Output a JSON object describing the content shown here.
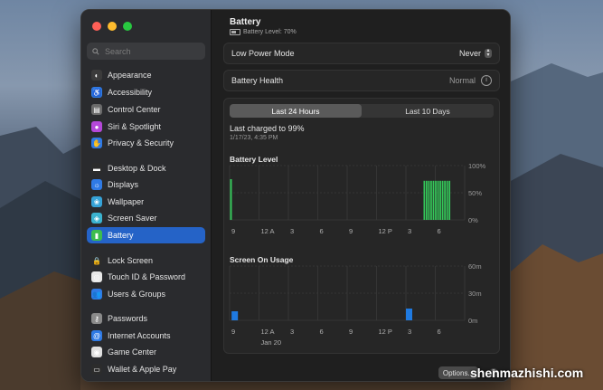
{
  "window": {
    "title": "Battery",
    "subtitle": "Battery Level: 70%"
  },
  "search": {
    "placeholder": "Search"
  },
  "sidebar": {
    "items": [
      {
        "label": "Appearance",
        "icon": "appearance-icon",
        "color": "#3b3b3b"
      },
      {
        "label": "Accessibility",
        "icon": "accessibility-icon",
        "color": "#2f7ae5"
      },
      {
        "label": "Control Center",
        "icon": "control-center-icon",
        "color": "#6b6b6b"
      },
      {
        "label": "Siri & Spotlight",
        "icon": "siri-icon",
        "color": "#b548d9"
      },
      {
        "label": "Privacy & Security",
        "icon": "hand-icon",
        "color": "#2f7ae5"
      },
      {
        "label": "Desktop & Dock",
        "icon": "dock-icon",
        "color": "#2c2c2c"
      },
      {
        "label": "Displays",
        "icon": "display-icon",
        "color": "#2f7ae5"
      },
      {
        "label": "Wallpaper",
        "icon": "wallpaper-icon",
        "color": "#36a3d8"
      },
      {
        "label": "Screen Saver",
        "icon": "screensaver-icon",
        "color": "#3bb3cf"
      },
      {
        "label": "Battery",
        "icon": "battery-icon",
        "color": "#3dbd4e"
      },
      {
        "label": "Lock Screen",
        "icon": "lock-icon",
        "color": "#2c2c2c"
      },
      {
        "label": "Touch ID & Password",
        "icon": "fingerprint-icon",
        "color": "#e8e8e8"
      },
      {
        "label": "Users & Groups",
        "icon": "users-icon",
        "color": "#2f7ae5"
      },
      {
        "label": "Passwords",
        "icon": "key-icon",
        "color": "#8a8a8a"
      },
      {
        "label": "Internet Accounts",
        "icon": "at-icon",
        "color": "#2f7ae5"
      },
      {
        "label": "Game Center",
        "icon": "game-center-icon",
        "color": "#e0e0e0"
      },
      {
        "label": "Wallet & Apple Pay",
        "icon": "wallet-icon",
        "color": "#2c2c2c"
      }
    ],
    "active": "Battery"
  },
  "rows": {
    "low_power": {
      "label": "Low Power Mode",
      "value": "Never"
    },
    "health": {
      "label": "Battery Health",
      "value": "Normal"
    }
  },
  "tabs": {
    "t1": "Last 24 Hours",
    "t2": "Last 10 Days",
    "selected": "Last 24 Hours"
  },
  "last_charged": {
    "text": "Last charged to 99%",
    "time": "1/17/23, 4:35 PM"
  },
  "sections": {
    "battery_level": "Battery Level",
    "screen_on": "Screen On Usage"
  },
  "footer": {
    "options": "Options...",
    "help": "?"
  },
  "watermark": "shenmazhishi.com",
  "chart_data": [
    {
      "type": "bar",
      "title": "Battery Level",
      "categories": [
        "9",
        "10",
        "11",
        "12 A",
        "1",
        "2",
        "3",
        "4",
        "5",
        "6",
        "7",
        "8",
        "9",
        "10",
        "11",
        "12 P",
        "1",
        "2",
        "3",
        "4",
        "5",
        "6",
        "7",
        "8"
      ],
      "tick_labels": [
        "9",
        "12 A",
        "3",
        "6",
        "9",
        "12 P",
        "3",
        "6"
      ],
      "y_tick_labels": [
        "100%",
        "50%",
        "0%"
      ],
      "ylim": [
        0,
        100
      ],
      "values": [
        75,
        null,
        null,
        null,
        null,
        null,
        null,
        null,
        null,
        null,
        null,
        null,
        null,
        null,
        null,
        null,
        null,
        null,
        null,
        null,
        null,
        72,
        null,
        null
      ],
      "charging_bars": {
        "start": 19.8,
        "end": 22.6,
        "level": 72,
        "count": 12
      },
      "color": "#34c759"
    },
    {
      "type": "bar",
      "title": "Screen On Usage",
      "categories": [
        "9",
        "10",
        "11",
        "12 A",
        "1",
        "2",
        "3",
        "4",
        "5",
        "6",
        "7",
        "8",
        "9",
        "10",
        "11",
        "12 P",
        "1",
        "2",
        "3",
        "4",
        "5",
        "6",
        "7",
        "8"
      ],
      "tick_labels": [
        "9",
        "12 A",
        "3",
        "6",
        "9",
        "12 P",
        "3",
        "6"
      ],
      "date_label": "Jan 20",
      "y_tick_labels": [
        "60m",
        "30m",
        "0m"
      ],
      "ylim": [
        0,
        60
      ],
      "values": [
        [
          0.2,
          10
        ],
        [
          18.0,
          13
        ]
      ],
      "color": "#1f7ae0"
    }
  ]
}
